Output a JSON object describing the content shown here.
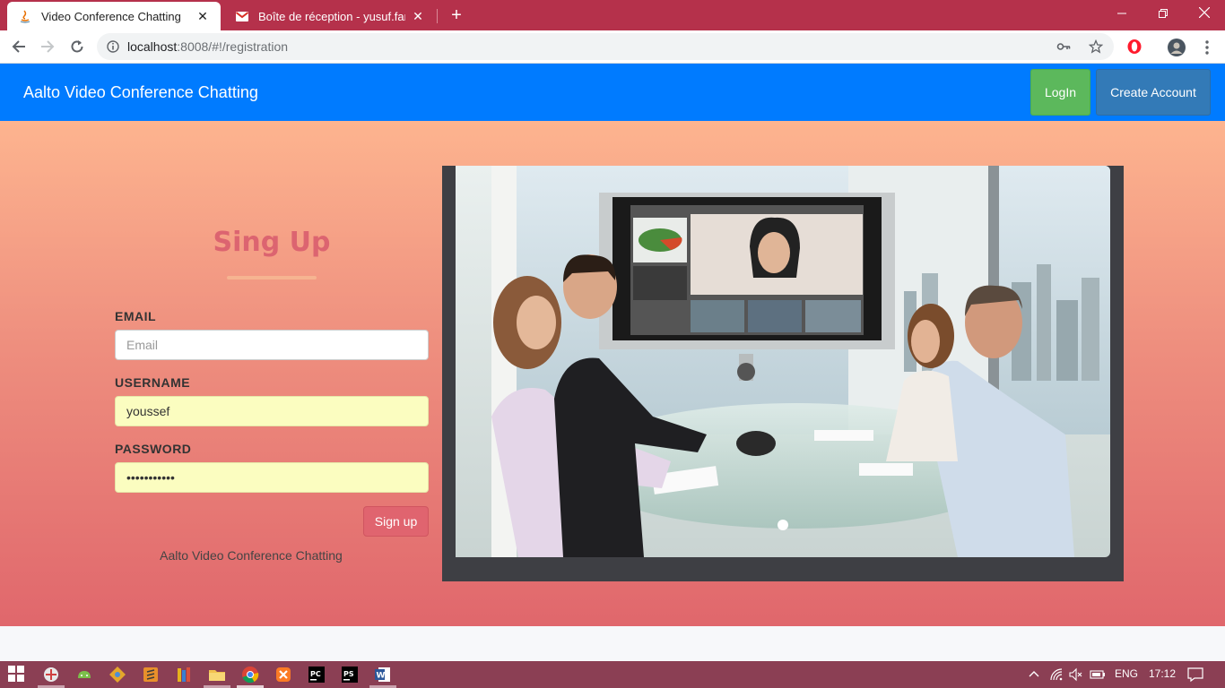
{
  "browser": {
    "tabs": [
      {
        "title": "Video Conference Chatting",
        "active": true
      },
      {
        "title": "Boîte de réception - yusuf.faraby",
        "active": false
      }
    ],
    "url_host": "localhost",
    "url_rest": ":8008/#!/registration",
    "new_tab_glyph": "+",
    "close_glyph": "✕"
  },
  "navbar": {
    "brand": "Aalto Video Conference Chatting",
    "login_label": "LogIn",
    "create_label": "Create Account"
  },
  "form": {
    "title": "Sing Up",
    "email_label": "EMAIL",
    "email_placeholder": "Email",
    "email_value": "",
    "username_label": "USERNAME",
    "username_value": "youssef",
    "password_label": "PASSWORD",
    "password_value": "•••••••••••",
    "submit_label": "Sign up",
    "footer": "Aalto Video Conference Chatting"
  },
  "carousel": {
    "image": "video-conference-meeting-photo",
    "active_slide": 1
  },
  "taskbar": {
    "language": "ENG",
    "time": "17:12"
  },
  "colors": {
    "tabbar": "#b5314b",
    "navbar": "#007bff",
    "login_button": "#5cb85c",
    "create_button": "#337ab7",
    "signup_button": "#e0646f",
    "title": "#dc6470",
    "taskbar": "#8b3f54"
  }
}
